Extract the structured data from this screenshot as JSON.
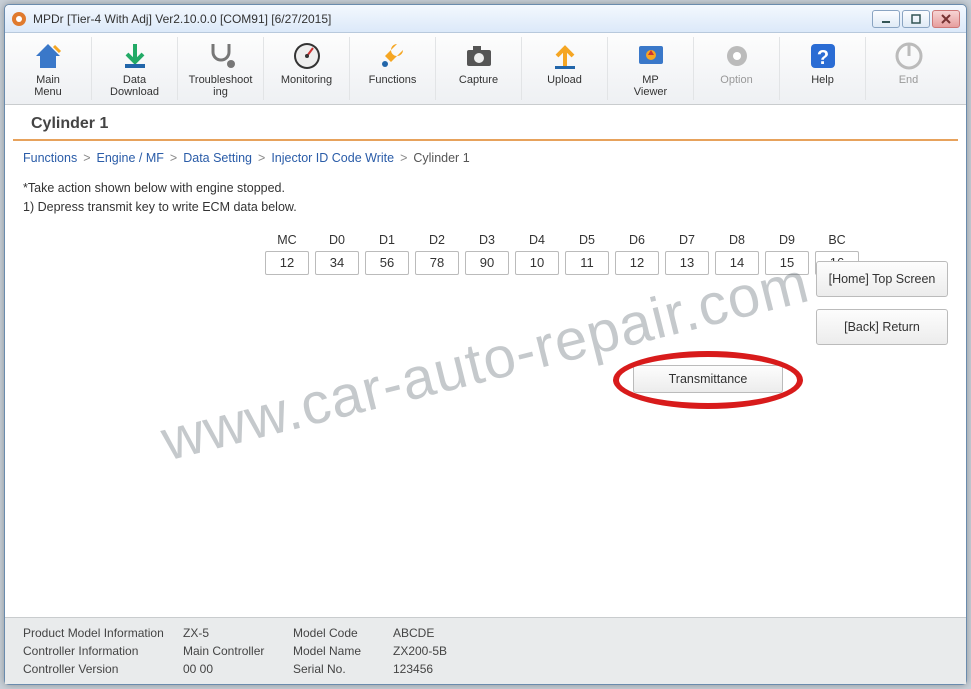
{
  "window": {
    "title": "MPDr [Tier-4 With Adj] Ver2.10.0.0 [COM91] [6/27/2015]"
  },
  "toolbar": {
    "items": [
      {
        "label": "Main Menu",
        "icon": "home"
      },
      {
        "label": "Data Download",
        "icon": "download"
      },
      {
        "label": "Troubleshooting",
        "icon": "stethoscope"
      },
      {
        "label": "Monitoring",
        "icon": "gauge"
      },
      {
        "label": "Functions",
        "icon": "wrench"
      },
      {
        "label": "Capture",
        "icon": "camera"
      },
      {
        "label": "Upload",
        "icon": "upload"
      },
      {
        "label": "MP Viewer",
        "icon": "viewer"
      },
      {
        "label": "Option",
        "icon": "gear",
        "disabled": true
      },
      {
        "label": "Help",
        "icon": "help"
      },
      {
        "label": "End",
        "icon": "power",
        "disabled": true
      }
    ]
  },
  "page": {
    "title": "Cylinder 1",
    "breadcrumb": [
      "Functions",
      "Engine / MF",
      "Data Setting",
      "Injector ID Code Write",
      "Cylinder 1"
    ],
    "instructions": [
      "*Take action shown below with engine stopped.",
      "1) Depress transmit key to write ECM data below."
    ],
    "columns": [
      {
        "header": "MC",
        "value": "12"
      },
      {
        "header": "D0",
        "value": "34"
      },
      {
        "header": "D1",
        "value": "56"
      },
      {
        "header": "D2",
        "value": "78"
      },
      {
        "header": "D3",
        "value": "90"
      },
      {
        "header": "D4",
        "value": "10"
      },
      {
        "header": "D5",
        "value": "11"
      },
      {
        "header": "D6",
        "value": "12"
      },
      {
        "header": "D7",
        "value": "13"
      },
      {
        "header": "D8",
        "value": "14"
      },
      {
        "header": "D9",
        "value": "15"
      },
      {
        "header": "BC",
        "value": "16"
      }
    ],
    "transmit_label": "Transmittance",
    "side_buttons": {
      "home": "[Home] Top Screen",
      "back": "[Back] Return"
    }
  },
  "footer": {
    "rows": [
      {
        "l1": "Product Model Information",
        "v1": "ZX-5",
        "l2": "Model Code",
        "v2": "ABCDE"
      },
      {
        "l1": "Controller Information",
        "v1": "Main Controller",
        "l2": "Model Name",
        "v2": "ZX200-5B"
      },
      {
        "l1": "Controller Version",
        "v1": "00 00",
        "l2": "Serial No.",
        "v2": "123456"
      }
    ]
  },
  "watermark": "www.car-auto-repair.com"
}
